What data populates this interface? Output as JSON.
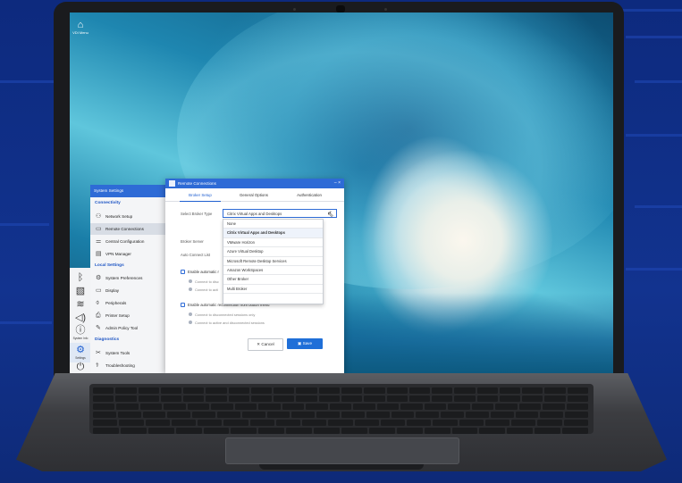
{
  "taskbar": {
    "vdi_menu_label": "VDI Menu",
    "system_info_label": "System Info",
    "settings_label": "Settings"
  },
  "system_settings": {
    "title": "System Settings",
    "sections": [
      {
        "heading": "Connectivity",
        "items": [
          "Network Setup",
          "Remote Connections",
          "Central Configuration",
          "VPN Manager"
        ]
      },
      {
        "heading": "Local Settings",
        "items": [
          "System Preferences",
          "Display",
          "Peripherals",
          "Printer Setup",
          "Admin Policy Tool"
        ]
      },
      {
        "heading": "Diagnostics",
        "items": [
          "System Tools",
          "Troubleshooting"
        ]
      }
    ],
    "selected_item": "Remote Connections"
  },
  "dialog": {
    "title": "Remote Connections",
    "tabs": [
      "Broker Setup",
      "General Options",
      "Authentication"
    ],
    "active_tab": "Broker Setup",
    "select_broker_label": "Select Broker Type",
    "select_broker_value": "Citrix Virtual Apps and Desktops",
    "broker_server_label": "Broker Server",
    "auto_connect_label": "Auto Connect List",
    "broker_options": [
      "None",
      "Citrix Virtual Apps and Desktops",
      "VMware Horizon",
      "Azure Virtual Desktop",
      "Microsoft Remote Desktop Services",
      "Amazon WorkSpaces",
      "Other Broker",
      "Multi Broker"
    ],
    "enable_auto_reconnect_partial": "Enable automatic r",
    "radio1_partial": "Connect to disc",
    "radio2_partial": "Connect to acti",
    "enable_reconnect_button_menu": "Enable automatic reconnection from button menu",
    "radio3": "Connect to disconnected sessions only",
    "radio4": "Connect to active and disconnected sessions",
    "cancel_label": "Cancel",
    "save_label": "Save"
  },
  "icons": [
    "home-icon",
    "bluetooth-icon",
    "wifi-icon",
    "volume-icon",
    "info-icon",
    "gear-icon",
    "power-icon"
  ]
}
